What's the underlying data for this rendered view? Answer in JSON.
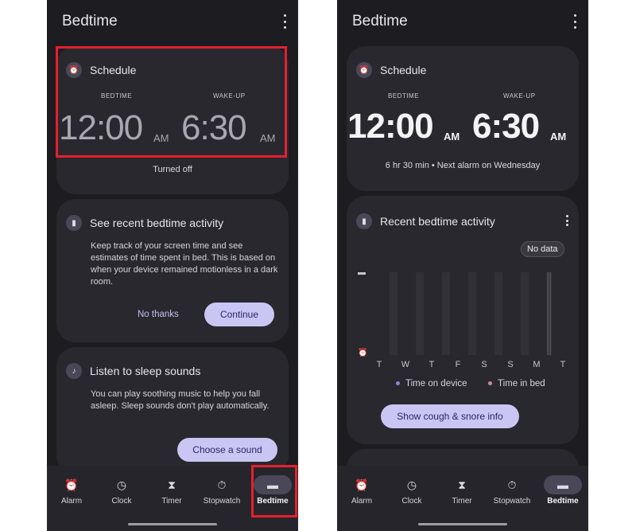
{
  "left": {
    "title": "Bedtime",
    "schedule": {
      "title": "Schedule",
      "bedtime_label": "BEDTIME",
      "wakeup_label": "WAKE-UP",
      "bedtime_time": "12:00",
      "bedtime_ampm": "AM",
      "wakeup_time": "6:30",
      "wakeup_ampm": "AM",
      "status": "Turned off"
    },
    "activity": {
      "title": "See recent bedtime activity",
      "body": "Keep track of your screen time and see estimates of time spent in bed. This is based on when your device remained motionless in a dark room.",
      "no_thanks": "No thanks",
      "continue": "Continue"
    },
    "sounds": {
      "title": "Listen to sleep sounds",
      "body": "You can play soothing music to help you fall asleep. Sleep sounds don't play automatically.",
      "choose": "Choose a sound"
    }
  },
  "right": {
    "title": "Bedtime",
    "schedule": {
      "title": "Schedule",
      "bedtime_label": "BEDTIME",
      "wakeup_label": "WAKE-UP",
      "bedtime_time": "12:00",
      "bedtime_ampm": "AM",
      "wakeup_time": "6:30",
      "wakeup_ampm": "AM",
      "status": "6 hr 30 min • Next alarm on Wednesday"
    },
    "recent": {
      "title": "Recent bedtime activity",
      "tooltip": "No data",
      "days": [
        "T",
        "W",
        "T",
        "F",
        "S",
        "S",
        "M",
        "T"
      ],
      "legend_device": "Time on device",
      "legend_bed": "Time in bed",
      "button": "Show cough & snore info"
    }
  },
  "nav": [
    {
      "label": "Alarm",
      "icon": "alarm-icon"
    },
    {
      "label": "Clock",
      "icon": "clock-icon"
    },
    {
      "label": "Timer",
      "icon": "hourglass-icon"
    },
    {
      "label": "Stopwatch",
      "icon": "stopwatch-icon"
    },
    {
      "label": "Bedtime",
      "icon": "bed-icon",
      "active": true
    }
  ],
  "colors": {
    "surface": "#1d1c21",
    "card": "#29282e",
    "accent": "#cac6f4",
    "highlight": "#e5202e",
    "device_dot": "#8a86d6",
    "bed_dot": "#c98a9a"
  }
}
